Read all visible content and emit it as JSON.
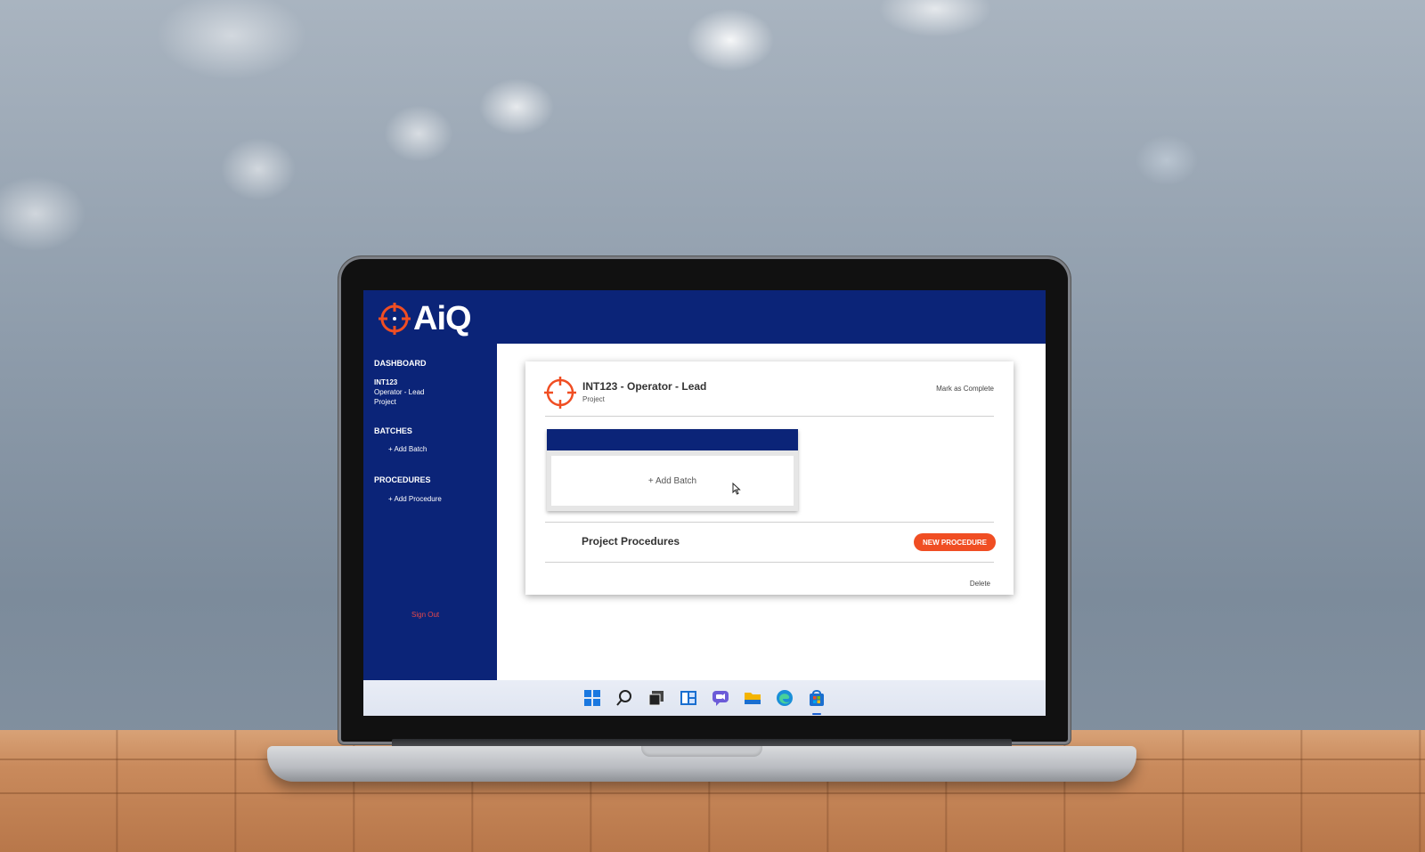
{
  "app": {
    "logo_text": "AiQ",
    "brand_color": "#0b2478",
    "accent_color": "#f04e23"
  },
  "sidebar": {
    "dashboard": "DASHBOARD",
    "project_code": "INT123",
    "project_name": "Operator - Lead",
    "project_type": "Project",
    "batches_heading": "BATCHES",
    "add_batch": "+ Add Batch",
    "procedures_heading": "PROCEDURES",
    "add_procedure": "+ Add Procedure",
    "sign_out": "Sign Out"
  },
  "card": {
    "title": "INT123 - Operator - Lead",
    "subtitle": "Project",
    "mark_complete": "Mark as Complete",
    "batch_add": "+ Add Batch",
    "procedures_title": "Project Procedures",
    "new_procedure": "NEW PROCEDURE",
    "delete": "Delete"
  },
  "taskbar": {
    "icons": [
      "windows-start-icon",
      "search-icon",
      "task-view-icon",
      "widgets-icon",
      "chat-icon",
      "file-explorer-icon",
      "edge-browser-icon",
      "store-icon"
    ],
    "active": "store-icon"
  }
}
